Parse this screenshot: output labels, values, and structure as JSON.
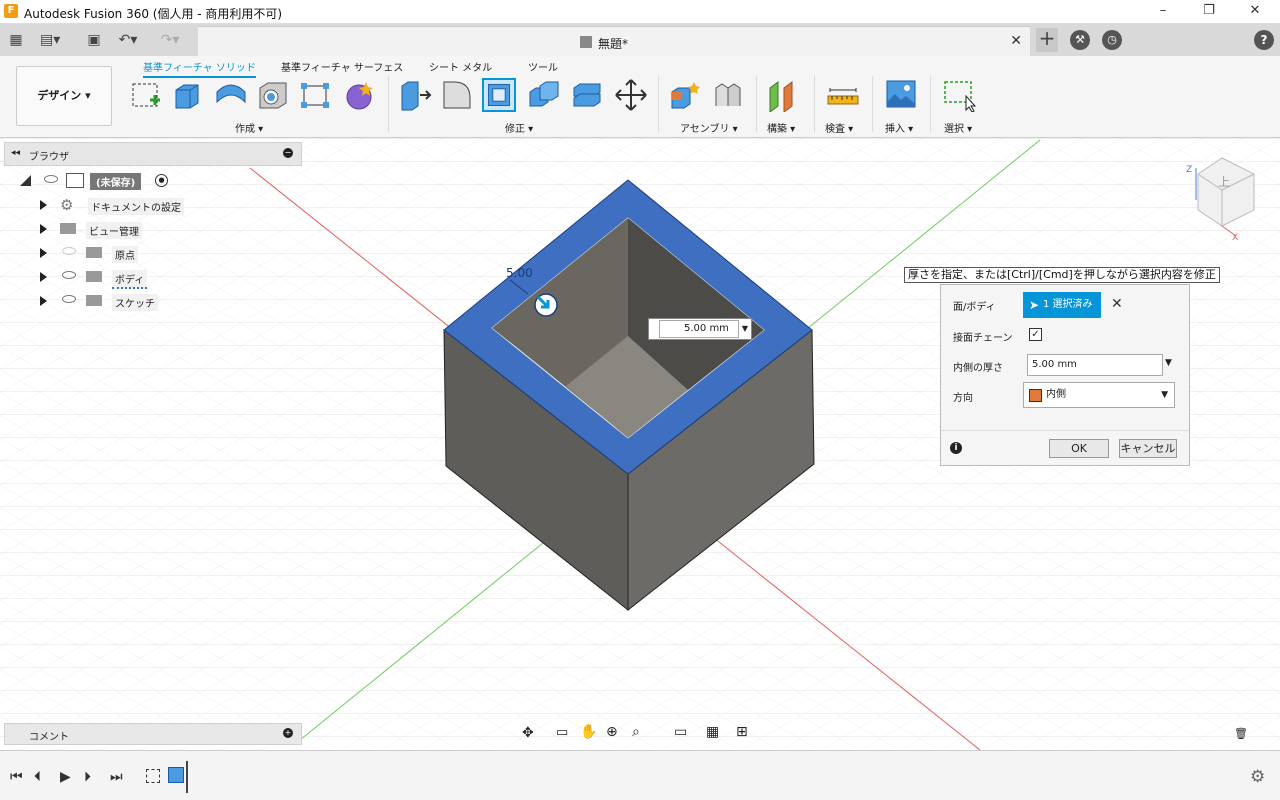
{
  "window": {
    "title": "Autodesk Fusion 360 (個人用 - 商用利用不可)",
    "minimize": "–",
    "maximize": "❐",
    "close": "✕"
  },
  "tabs": {
    "doc_title": "無題*",
    "new_tab": "+"
  },
  "ribbon": {
    "workspace": "デザイン ▾",
    "tabs": [
      "基準フィーチャ ソリッド",
      "基準フィーチャ サーフェス",
      "シート メタル",
      "ツール"
    ],
    "groups": [
      "作成 ▾",
      "修正 ▾",
      "アセンブリ ▾",
      "構築 ▾",
      "検査 ▾",
      "挿入 ▾",
      "選択 ▾"
    ]
  },
  "browser": {
    "title": "ブラウザ",
    "root": "(未保存)",
    "items": [
      "ドキュメントの設定",
      "ビュー管理",
      "原点",
      "ボディ",
      "スケッチ"
    ]
  },
  "comment": {
    "label": "コメント"
  },
  "tooltip": "厚さを指定、または[Ctrl]/[Cmd]を押しながら選択内容を修正",
  "shell_dialog": {
    "face_body_label": "面/ボディ",
    "selection": "1 選択済み",
    "tangent_chain_label": "接面チェーン",
    "tangent_chain_checked": "✓",
    "inside_thickness_label": "内側の厚さ",
    "inside_thickness_value": "5.00 mm",
    "direction_label": "方向",
    "direction_value": "内側",
    "ok": "OK",
    "cancel": "キャンセル"
  },
  "viewport": {
    "inline_dim": "5.00 mm",
    "dim_label": "5.00"
  },
  "colors": {
    "accent": "#0696d7",
    "selected_face": "#3f6fc1",
    "body": "#6a6863",
    "grid_red": "#e05555",
    "grid_green": "#66cc55"
  }
}
